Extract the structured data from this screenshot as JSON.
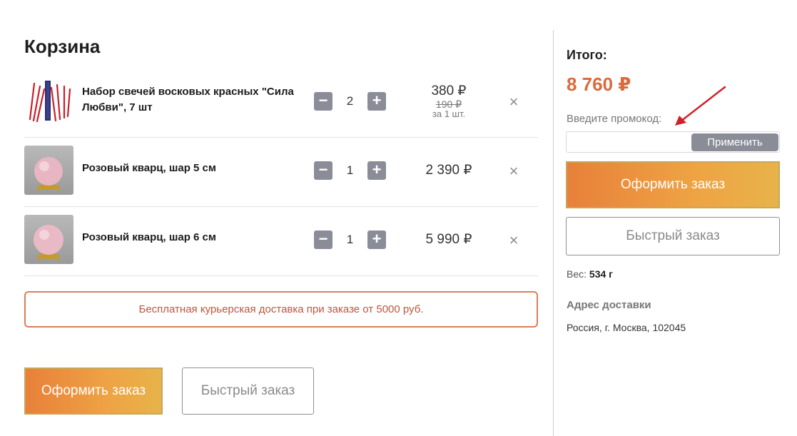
{
  "page": {
    "title": "Корзина"
  },
  "cart": {
    "items": [
      {
        "name": "Набор свечей восковых красных \"Сила Любви\", 7 шт",
        "quantity": "2",
        "price": "380 ₽",
        "unit_price": "190 ₽",
        "unit_label": "за 1 шт.",
        "image": "red-candles"
      },
      {
        "name": "Розовый кварц, шар 5 см",
        "quantity": "1",
        "price": "2 390 ₽",
        "image": "rose-quartz-sphere"
      },
      {
        "name": "Розовый кварц, шар 6 см",
        "quantity": "1",
        "price": "5 990 ₽",
        "image": "rose-quartz-sphere"
      }
    ],
    "qty_minus": "−",
    "qty_plus": "+",
    "remove_symbol": "×"
  },
  "delivery_note": "Бесплатная курьерская доставка при заказе от 5000 руб.",
  "buttons": {
    "order": "Оформить заказ",
    "quick_order": "Быстрый заказ",
    "apply": "Применить"
  },
  "summary": {
    "total_label": "Итого:",
    "total_value": "8 760 ₽",
    "promo_label": "Введите промокод:",
    "promo_value": "",
    "weight_label": "Вес:",
    "weight_value": "534 г",
    "address_title": "Адрес доставки",
    "address_value": "Россия, г. Москва, 102045"
  },
  "colors": {
    "accent": "#d96b3c",
    "button_gradient_start": "#e8803a",
    "button_gradient_end": "#e8b34a",
    "qty_button": "#8a8d98",
    "annotation_arrow": "#d0202a"
  }
}
